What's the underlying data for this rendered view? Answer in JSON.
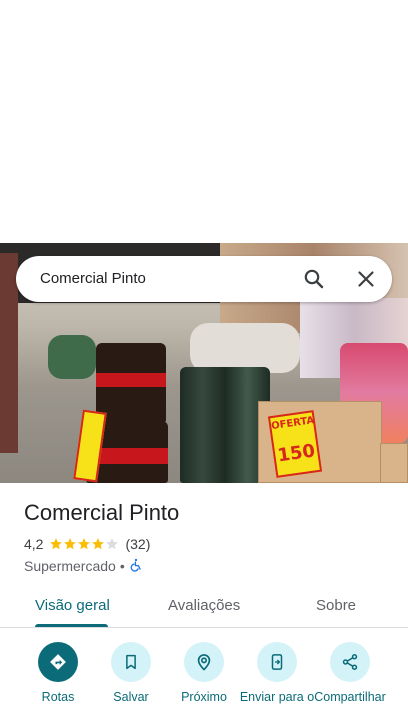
{
  "search": {
    "query": "Comercial Pinto"
  },
  "place": {
    "name": "Comercial Pinto",
    "rating": "4,2",
    "rating_value": 4.2,
    "review_count": "(32)",
    "category": "Supermercado",
    "separator": "•"
  },
  "photo_signs": {
    "offer": "OFERTA",
    "price": "150"
  },
  "tabs": [
    {
      "label": "Visão geral",
      "active": true
    },
    {
      "label": "Avaliações",
      "active": false
    },
    {
      "label": "Sobre",
      "active": false
    }
  ],
  "actions": [
    {
      "label": "Rotas",
      "icon": "directions-icon"
    },
    {
      "label": "Salvar",
      "icon": "bookmark-icon"
    },
    {
      "label": "Próximo",
      "icon": "nearby-icon"
    },
    {
      "label": "Enviar para o",
      "icon": "send-to-phone-icon"
    },
    {
      "label": "Compartilhar",
      "icon": "share-icon"
    }
  ],
  "colors": {
    "accent": "#0b6b78",
    "accent_light": "#d3f3f8",
    "star": "#fbbc04",
    "star_empty": "#dadce0",
    "accessibility": "#1a73e8"
  }
}
